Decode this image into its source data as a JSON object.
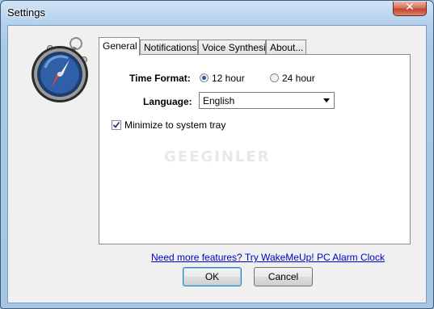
{
  "window": {
    "title": "Settings"
  },
  "tabs": [
    {
      "label": "General",
      "active": true
    },
    {
      "label": "Notifications",
      "active": false
    },
    {
      "label": "Voice Synthesis",
      "active": false
    },
    {
      "label": "About...",
      "active": false
    }
  ],
  "general": {
    "time_format_label": "Time Format:",
    "time_format_options": [
      "12 hour",
      "24 hour"
    ],
    "time_format_selected": "12 hour",
    "language_label": "Language:",
    "language_value": "English",
    "minimize_label": "Minimize to system tray",
    "minimize_checked": true,
    "watermark": "GEEGINLER"
  },
  "footer": {
    "link_text": "Need more features? Try WakeMeUp! PC Alarm Clock",
    "ok_label": "OK",
    "cancel_label": "Cancel"
  },
  "colors": {
    "link": "#0000cc",
    "accent": "#2a5a9e"
  },
  "icons": {
    "app": "stopwatch-icon",
    "close": "close-icon",
    "dropdown": "chevron-down-icon",
    "check": "checkmark-icon"
  }
}
